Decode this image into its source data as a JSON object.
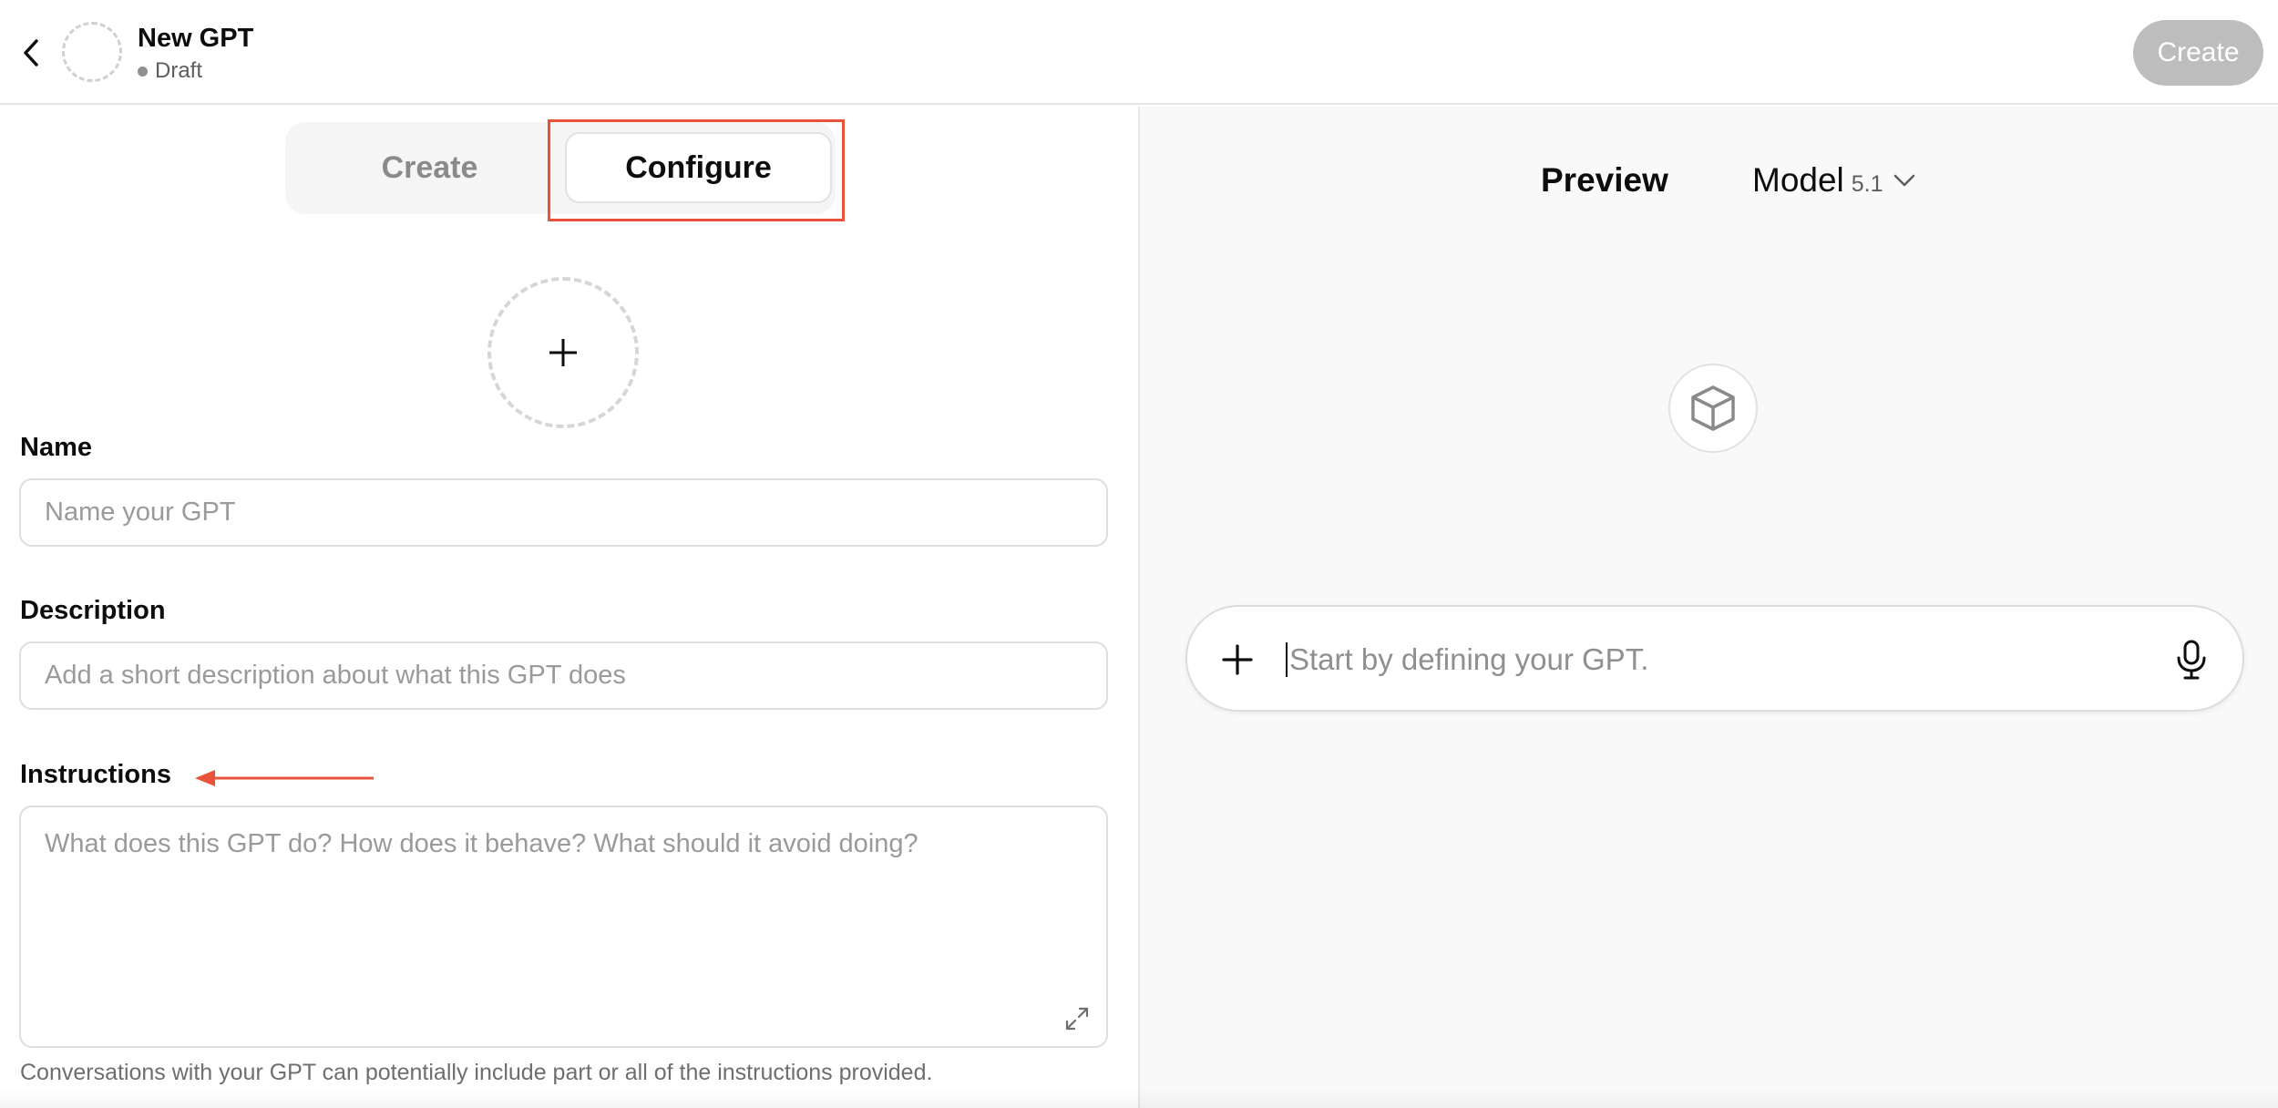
{
  "header": {
    "title": "New GPT",
    "status": "Draft",
    "create_button": "Create"
  },
  "tabs": {
    "create": "Create",
    "configure": "Configure",
    "active": "configure"
  },
  "form": {
    "name_label": "Name",
    "name_placeholder": "Name your GPT",
    "description_label": "Description",
    "description_placeholder": "Add a short description about what this GPT does",
    "instructions_label": "Instructions",
    "instructions_placeholder": "What does this GPT do? How does it behave? What should it avoid doing?",
    "instructions_note": "Conversations with your GPT can potentially include part or all of the instructions provided."
  },
  "preview": {
    "title": "Preview",
    "model_label": "Model",
    "model_version": "5.1",
    "composer_placeholder": "Start by defining your GPT."
  },
  "colors": {
    "annotation": "#e8533a",
    "create_button_bg": "#bdbdbd"
  },
  "icons": {
    "back": "chevron-left-icon",
    "add_image": "plus-icon",
    "expand": "expand-icon",
    "model_dropdown": "chevron-down-icon",
    "preview_avatar": "cube-icon",
    "composer_add": "plus-icon",
    "voice": "microphone-icon"
  }
}
